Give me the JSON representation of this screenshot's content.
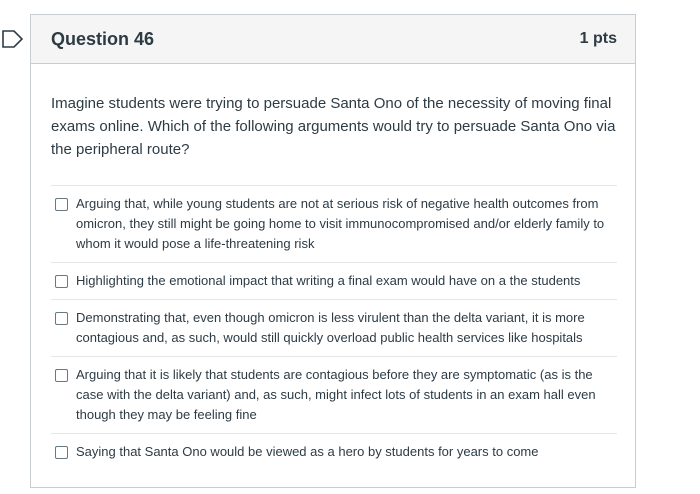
{
  "question": {
    "title": "Question 46",
    "points": "1 pts",
    "text": "Imagine students were trying to persuade Santa Ono of the necessity of moving final exams online. Which of the following arguments would try to persuade Santa Ono via the peripheral route?",
    "flag_icon": "flag-icon",
    "answers": [
      {
        "label": "Arguing that, while young students are not at serious risk of negative health outcomes from omicron, they still might be going home to visit immunocompromised and/or elderly family to whom it would pose a life-threatening risk",
        "checked": false
      },
      {
        "label": "Highlighting the emotional impact that writing a final exam would have on a the students",
        "checked": false
      },
      {
        "label": "Demonstrating that, even though omicron is less virulent than the delta variant, it is more contagious and, as such, would still quickly overload public health services like hospitals",
        "checked": false
      },
      {
        "label": "Arguing that it is likely that students are contagious before they are symptomatic (as is the case with the delta variant) and, as such, might infect lots of students in an exam hall even though they may be feeling fine",
        "checked": false
      },
      {
        "label": "Saying that Santa Ono would be viewed as a hero by students for years to come",
        "checked": false
      }
    ]
  },
  "colors": {
    "text": "#2d3b45",
    "header_bg": "#f5f5f5",
    "border": "#c7cdd1",
    "flag_stroke": "#2d3b45"
  }
}
